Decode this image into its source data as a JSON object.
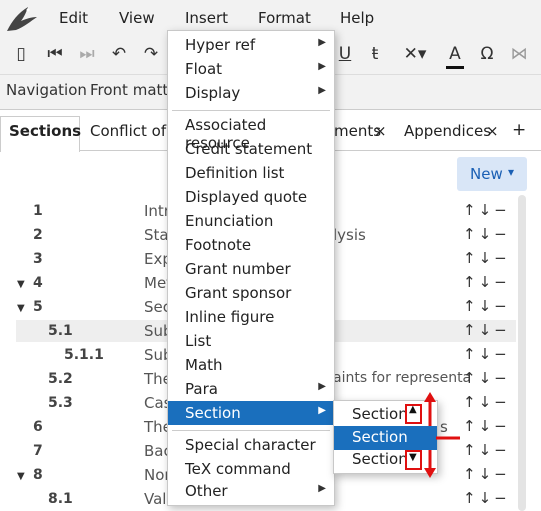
{
  "menubar": {
    "items": [
      "Edit",
      "View",
      "Insert",
      "Format",
      "Help"
    ]
  },
  "nav": {
    "navigation": "Navigation",
    "front_matter": "Front matte"
  },
  "tabs": {
    "sections": "Sections",
    "conflict": "Conflict of i",
    "documents": "ments",
    "appendices": "Appendices",
    "close": "×",
    "add": "+"
  },
  "new_button": {
    "label": "New",
    "caret": "▾"
  },
  "rows": [
    {
      "num": "1",
      "text": "Intr"
    },
    {
      "num": "2",
      "text": "Sta",
      "extra": "lysis"
    },
    {
      "num": "3",
      "text": "Exp"
    },
    {
      "num": "4",
      "text": "Met"
    },
    {
      "num": "5",
      "text": "Sec"
    },
    {
      "num": "5.1",
      "text": "Sub"
    },
    {
      "num": "5.1.1",
      "text": "Sub"
    },
    {
      "num": "5.2",
      "text": "The",
      "extra": "aints for representa"
    },
    {
      "num": "5.3",
      "text": "Cas"
    },
    {
      "num": "6",
      "text": "The",
      "extra": "s"
    },
    {
      "num": "7",
      "text": "Bac"
    },
    {
      "num": "8",
      "text": "Nor"
    },
    {
      "num": "8.1",
      "text": "Val"
    }
  ],
  "row_controls": "↑↓−",
  "insert_menu": {
    "items": [
      {
        "label": "Hyper ref",
        "sub": true
      },
      {
        "label": "Float",
        "sub": true
      },
      {
        "label": "Display",
        "sub": true
      },
      {
        "label": "Associated resource"
      },
      {
        "label": "Credit statement"
      },
      {
        "label": "Definition list"
      },
      {
        "label": "Displayed quote"
      },
      {
        "label": "Enunciation"
      },
      {
        "label": "Footnote"
      },
      {
        "label": "Grant number"
      },
      {
        "label": "Grant sponsor"
      },
      {
        "label": "Inline figure"
      },
      {
        "label": "List"
      },
      {
        "label": "Math"
      },
      {
        "label": "Para",
        "sub": true
      },
      {
        "label": "Section",
        "sub": true,
        "selected": true
      },
      {
        "label": "Special character"
      },
      {
        "label": "TeX command"
      },
      {
        "label": "Other",
        "sub": true
      }
    ]
  },
  "section_submenu": {
    "items": [
      "Section",
      "Section",
      "Section"
    ]
  },
  "colors": {
    "accent": "#1a6fbd",
    "annotation": "#e01010"
  }
}
